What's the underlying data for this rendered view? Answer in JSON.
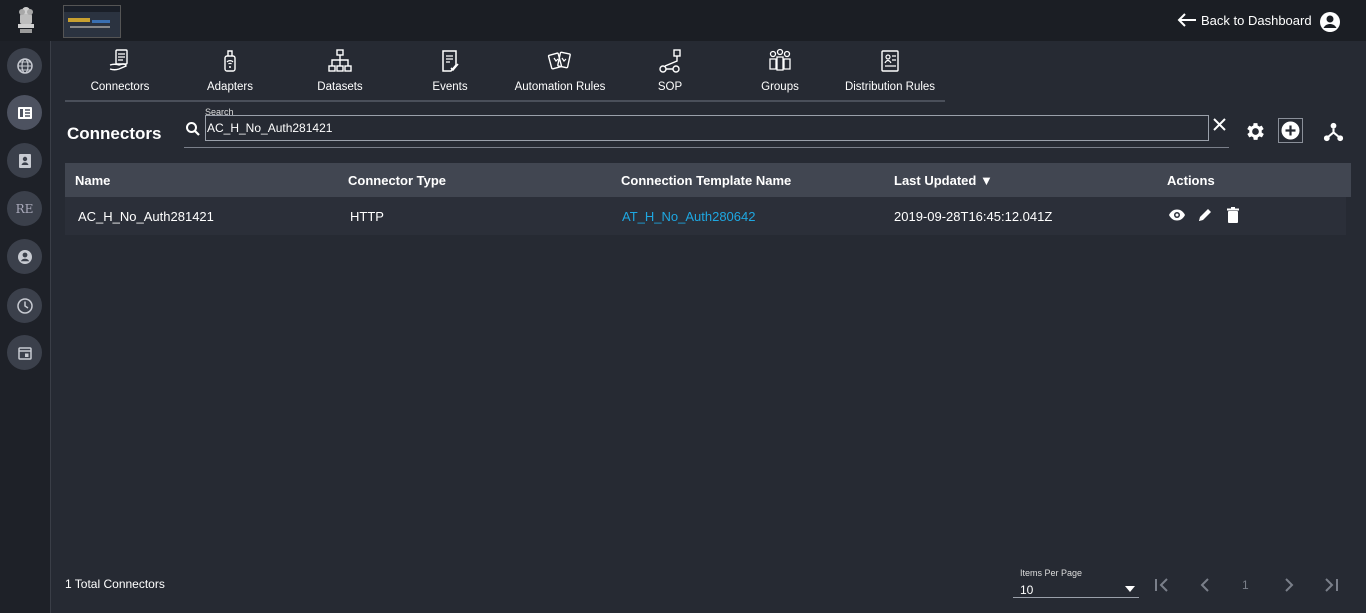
{
  "header": {
    "back_label": "Back to Dashboard"
  },
  "sidebar": {
    "items": [
      {
        "icon": "globe-icon"
      },
      {
        "icon": "list-icon",
        "active": true
      },
      {
        "icon": "contact-card-icon"
      },
      {
        "icon": "re-icon",
        "text": "RE"
      },
      {
        "icon": "user-circle-icon"
      },
      {
        "icon": "clock-icon"
      },
      {
        "icon": "calendar-icon"
      }
    ]
  },
  "modules": [
    {
      "label": "Connectors",
      "icon": "connectors-icon"
    },
    {
      "label": "Adapters",
      "icon": "adapter-icon"
    },
    {
      "label": "Datasets",
      "icon": "datasets-icon"
    },
    {
      "label": "Events",
      "icon": "events-icon"
    },
    {
      "label": "Automation Rules",
      "icon": "automation-rules-icon"
    },
    {
      "label": "SOP",
      "icon": "sop-icon"
    },
    {
      "label": "Groups",
      "icon": "groups-icon"
    },
    {
      "label": "Distribution Rules",
      "icon": "distribution-rules-icon"
    }
  ],
  "page": {
    "title": "Connectors"
  },
  "search": {
    "label": "Search",
    "value": "AC_H_No_Auth281421"
  },
  "table": {
    "columns": [
      "Name",
      "Connector Type",
      "Connection Template Name",
      "Last Updated ▼",
      "Actions"
    ],
    "rows": [
      {
        "name": "AC_H_No_Auth281421",
        "type": "HTTP",
        "template": "AT_H_No_Auth280642",
        "updated": "2019-09-28T16:45:12.041Z"
      }
    ]
  },
  "footer": {
    "total": "1 Total Connectors",
    "items_per_page_label": "Items Per Page",
    "items_per_page": "10",
    "current_page": "1"
  },
  "colors": {
    "background": "#262a33",
    "topbar": "#1b1e24",
    "table_header": "#414651",
    "link": "#1ea7e1"
  }
}
